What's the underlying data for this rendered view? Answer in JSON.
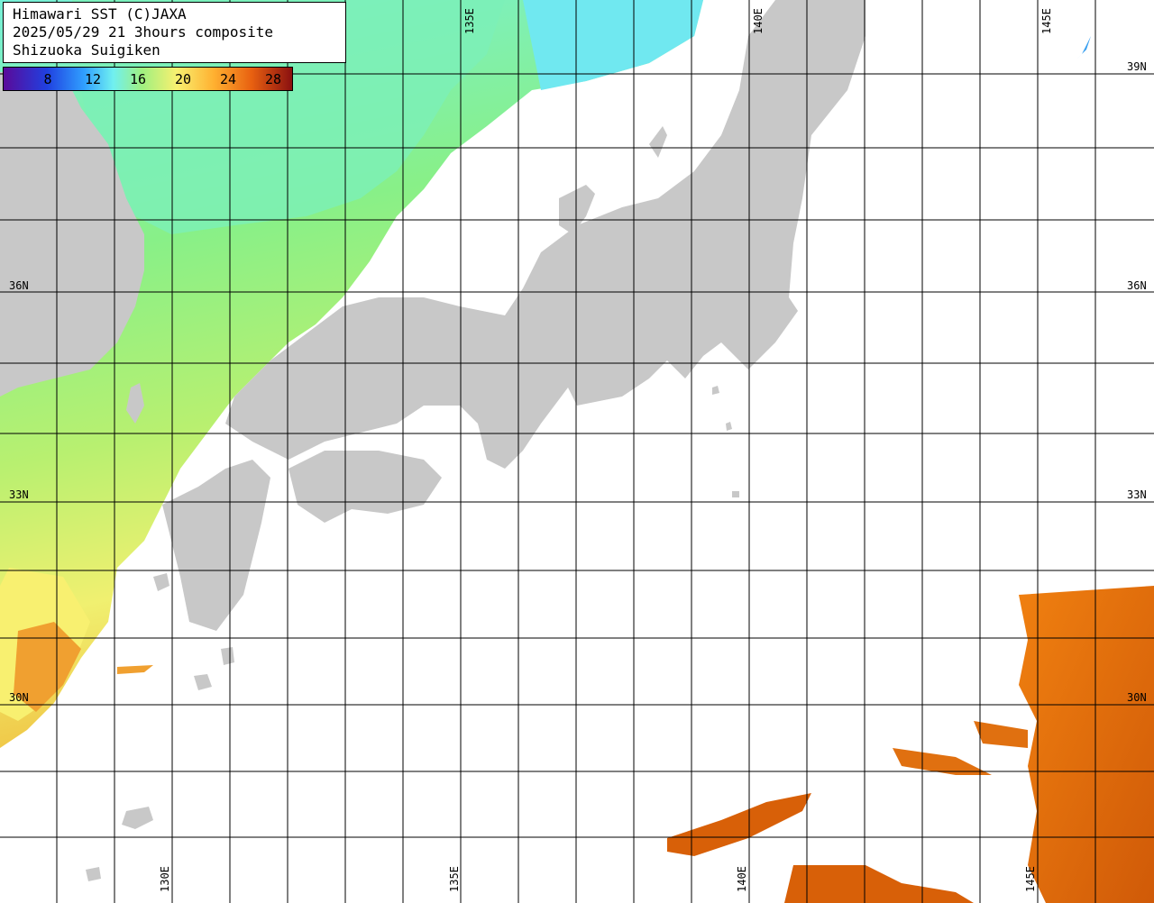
{
  "title": {
    "line1": "Himawari SST (C)JAXA",
    "line2": "2025/05/29 21 3hours composite",
    "line3": "Shizuoka Suigiken"
  },
  "colorbar": {
    "ticks": [
      "8",
      "12",
      "16",
      "20",
      "24",
      "28"
    ],
    "colors": [
      "#5a0a9a",
      "#2040e0",
      "#30a0ff",
      "#70f0f0",
      "#a0f080",
      "#f8f070",
      "#ffb030",
      "#e86010",
      "#8a1010"
    ]
  },
  "lat_labels": {
    "n39": "39N",
    "n36": "36N",
    "n33": "33N",
    "n30": "30N"
  },
  "lon_labels": {
    "e130": "130E",
    "e135": "135E",
    "e140": "140E",
    "e145": "145E"
  },
  "colors": {
    "land": "#c8c8c8",
    "grid": "#000000",
    "sst_cool": "#70f0d0",
    "sst_mild": "#90f080",
    "sst_warm": "#f0f070",
    "sst_hot": "#e07010"
  }
}
